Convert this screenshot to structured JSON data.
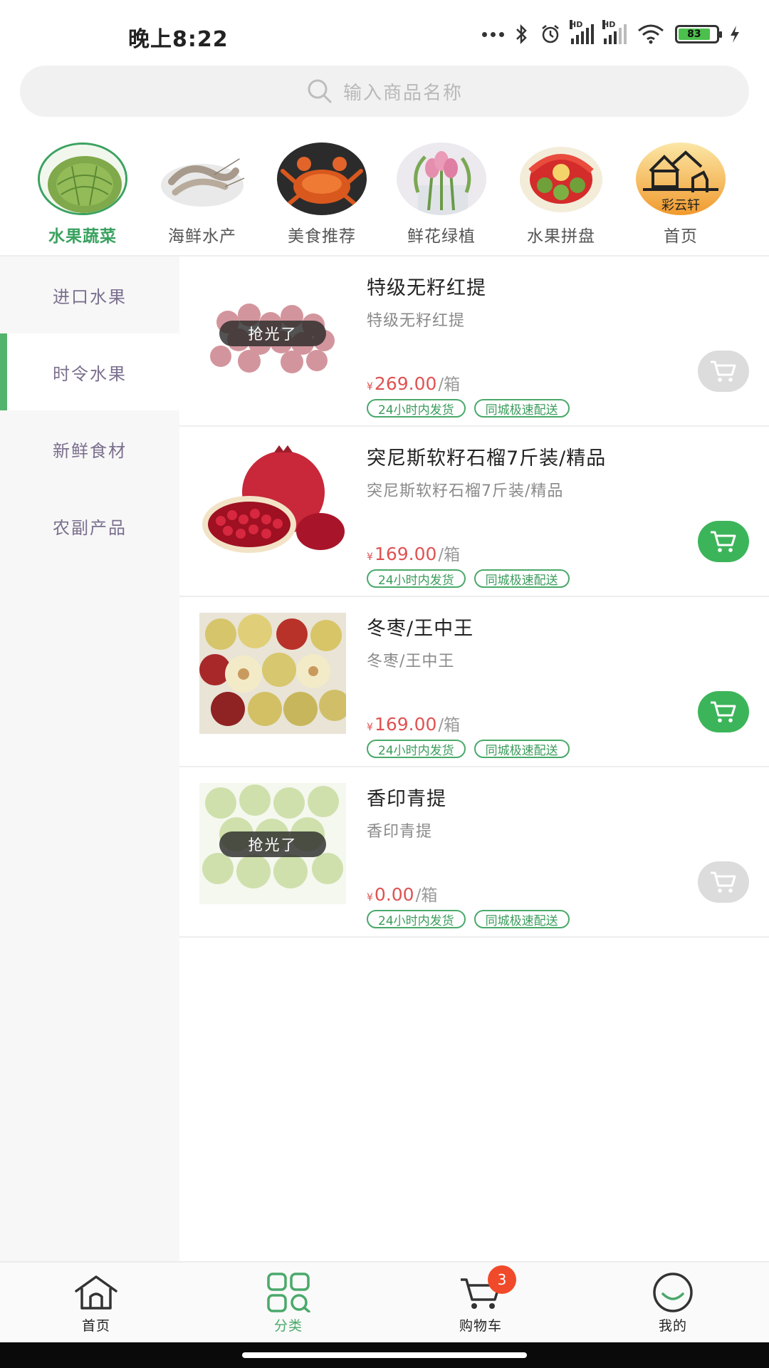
{
  "status": {
    "time": "晚上8:22",
    "battery": "83"
  },
  "search": {
    "placeholder": "输入商品名称",
    "icon": "search-icon"
  },
  "categories": [
    {
      "label": "水果蔬菜",
      "active": true
    },
    {
      "label": "海鲜水产",
      "active": false
    },
    {
      "label": "美食推荐",
      "active": false
    },
    {
      "label": "鲜花绿植",
      "active": false
    },
    {
      "label": "水果拼盘",
      "active": false
    },
    {
      "label": "首页",
      "active": false
    }
  ],
  "sidebar": {
    "items": [
      {
        "label": "进口水果",
        "active": false
      },
      {
        "label": "时令水果",
        "active": true
      },
      {
        "label": "新鲜食材",
        "active": false
      },
      {
        "label": "农副产品",
        "active": false
      }
    ]
  },
  "products": [
    {
      "title": "特级无籽红提",
      "subtitle": "特级无籽红提",
      "currency": "¥",
      "price": "269.00",
      "unit": "/箱",
      "soldout": "抢光了",
      "cart_enabled": false,
      "tags": [
        "24小时内发货",
        "同城极速配送"
      ]
    },
    {
      "title": "突尼斯软籽石榴7斤装/精品",
      "subtitle": "突尼斯软籽石榴7斤装/精品",
      "currency": "¥",
      "price": "169.00",
      "unit": "/箱",
      "cart_enabled": true,
      "tags": [
        "24小时内发货",
        "同城极速配送"
      ]
    },
    {
      "title": "冬枣/王中王",
      "subtitle": "冬枣/王中王",
      "currency": "¥",
      "price": "169.00",
      "unit": "/箱",
      "cart_enabled": true,
      "tags": [
        "24小时内发货",
        "同城极速配送"
      ]
    },
    {
      "title": "香印青提",
      "subtitle": "香印青提",
      "currency": "¥",
      "price": "0.00",
      "unit": "/箱",
      "soldout": "抢光了",
      "cart_enabled": false,
      "tags": [
        "24小时内发货",
        "同城极速配送"
      ]
    }
  ],
  "bottom_nav": {
    "items": [
      {
        "label": "首页",
        "icon": "home-icon"
      },
      {
        "label": "分类",
        "icon": "category-icon",
        "active": true
      },
      {
        "label": "购物车",
        "icon": "cart-icon",
        "badge": "3"
      },
      {
        "label": "我的",
        "icon": "profile-icon"
      }
    ]
  },
  "colors": {
    "accent": "#3aa260",
    "price": "#e05252",
    "badge": "#f04a2a"
  }
}
